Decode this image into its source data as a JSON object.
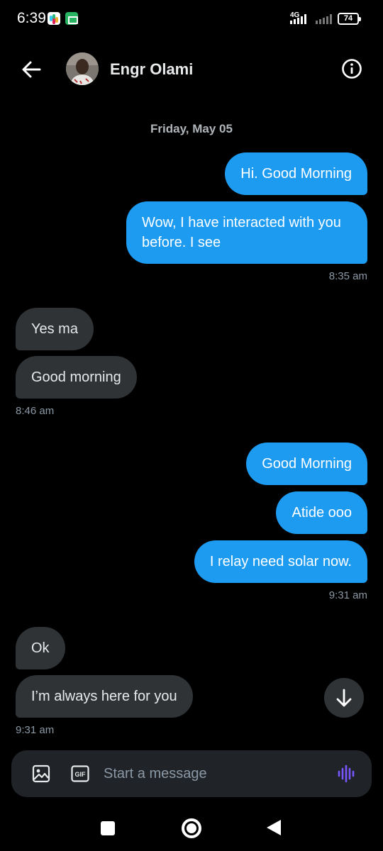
{
  "status_bar": {
    "time": "6:39",
    "network": "4G",
    "battery": "74",
    "icons": [
      "slack-icon",
      "meet-icon",
      "signal-icon",
      "wifi-off-icon",
      "battery-icon"
    ]
  },
  "header": {
    "contact_name": "Engr Olami",
    "icons": [
      "back-arrow-icon",
      "info-icon"
    ]
  },
  "conversation": {
    "date": "Friday, May 05",
    "groups": [
      {
        "direction": "sent",
        "messages": [
          "Hi. Good Morning",
          "Wow, I have interacted with you before. I see"
        ],
        "time": "8:35 am"
      },
      {
        "direction": "received",
        "messages": [
          "Yes ma",
          "Good morning"
        ],
        "time": "8:46 am"
      },
      {
        "direction": "sent",
        "messages": [
          "Good Morning",
          "Atide ooo",
          "I relay need solar now."
        ],
        "time": "9:31 am"
      },
      {
        "direction": "received",
        "messages": [
          "Ok",
          "I’m always here for you"
        ],
        "time": "9:31 am"
      }
    ]
  },
  "composer": {
    "placeholder": "Start a message",
    "gif_label": "GIF",
    "icons": [
      "image-icon",
      "gif-icon",
      "voice-icon"
    ]
  },
  "colors": {
    "background": "#000000",
    "sent_bubble": "#1d9bf0",
    "received_bubble": "#2f3336",
    "voice_accent": "#7856ff"
  }
}
